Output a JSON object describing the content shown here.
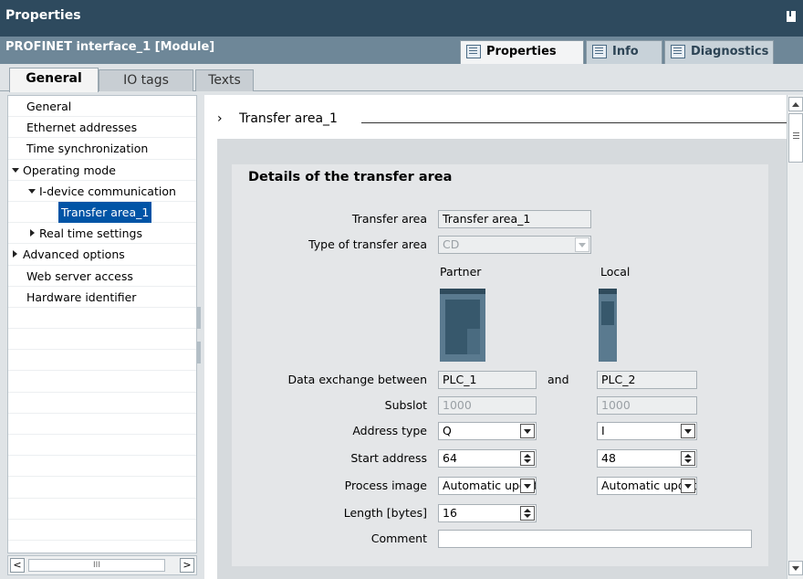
{
  "window": {
    "title": "Properties"
  },
  "module": {
    "name": "PROFINET interface_1 [Module]"
  },
  "right_tabs": [
    {
      "label": "Properties",
      "icon": "properties-icon"
    },
    {
      "label": "Info",
      "icon": "info-icon"
    },
    {
      "label": "Diagnostics",
      "icon": "diagnostics-icon"
    }
  ],
  "sub_tabs": [
    "General",
    "IO tags",
    "Texts"
  ],
  "nav": [
    {
      "label": "General"
    },
    {
      "label": "Ethernet addresses"
    },
    {
      "label": "Time synchronization"
    },
    {
      "label": "Operating mode",
      "state": "expanded"
    },
    {
      "label": "I-device communication",
      "state": "expanded"
    },
    {
      "label": "Transfer area_1",
      "state": "selected"
    },
    {
      "label": "Real time settings",
      "state": "collapsed"
    },
    {
      "label": "Advanced options",
      "state": "collapsed"
    },
    {
      "label": "Web server access"
    },
    {
      "label": "Hardware identifier"
    }
  ],
  "section": {
    "title": "Transfer area_1"
  },
  "panel": {
    "title": "Details of the transfer area",
    "labels": {
      "transfer_area": "Transfer area",
      "type": "Type of transfer area",
      "data_exchange": "Data exchange between",
      "and": "and",
      "subslot": "Subslot",
      "address_type": "Address type",
      "start_address": "Start address",
      "process_image": "Process image",
      "length": "Length [bytes]",
      "comment": "Comment"
    },
    "columns": {
      "partner": "Partner",
      "local": "Local"
    },
    "transfer_area_value": "Transfer area_1",
    "type_value": "CD",
    "partner": {
      "plc": "PLC_1",
      "subslot": "1000",
      "address_type": "Q",
      "start_address": "64",
      "process_image": "Automatic update",
      "length": "16"
    },
    "local": {
      "plc": "PLC_2",
      "subslot": "1000",
      "address_type": "I",
      "start_address": "48",
      "process_image": "Automatic update"
    },
    "comment_value": ""
  },
  "scrollbar": {
    "thumb_glyph": "III",
    "left_arrow": "<",
    "right_arrow": ">"
  },
  "colors": {
    "title_bar": "#2e4a5e",
    "module_bar": "#6e8798",
    "selection": "#0054a6"
  }
}
